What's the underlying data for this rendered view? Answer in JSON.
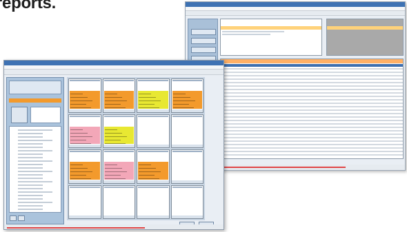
{
  "heading": {
    "text": "reports."
  },
  "colors": {
    "orange": "#f39a2c",
    "yellow": "#e8e832",
    "pink": "#f3a7b8",
    "titlebar_blue": "#3e72b3",
    "header_orange": "#ffb066",
    "status_red": "#e04444"
  },
  "calendar_grid": {
    "rows": 4,
    "columns": 4,
    "cells": [
      [
        "orange",
        "orange",
        "yellow",
        "orange"
      ],
      [
        "pink",
        "yellow",
        "white",
        "white"
      ],
      [
        "orange",
        "pink",
        "orange",
        "white"
      ],
      [
        "white",
        "white",
        "white",
        "white"
      ]
    ]
  },
  "back_grid": {
    "selected_row": 1
  }
}
